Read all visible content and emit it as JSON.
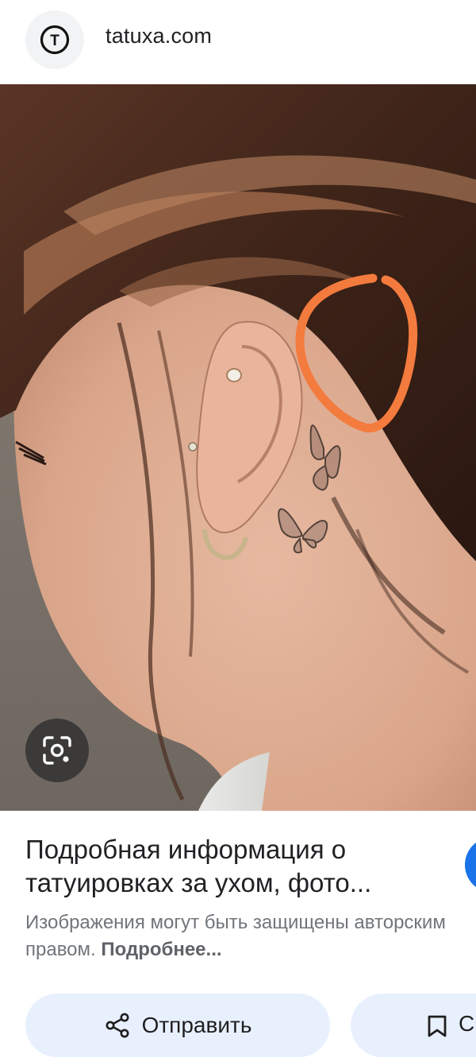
{
  "header": {
    "favicon_letter": "T",
    "site": "tatuxa.com"
  },
  "image": {
    "description_icons": [
      "google-lens-icon"
    ],
    "annotation_color": "#f47b3e"
  },
  "result": {
    "title": "Подробная информация о\nтатуировках за ухом, фото...",
    "notice_text": "Изображения могут быть защищены авторским",
    "notice_text_2": "правом.",
    "notice_link": "Подробнее..."
  },
  "actions": {
    "share_label": "Отправить",
    "save_label": "С"
  },
  "colors": {
    "accent": "#1a73e8",
    "button_bg": "#e8f0fe",
    "secondary_text": "#70757a"
  }
}
